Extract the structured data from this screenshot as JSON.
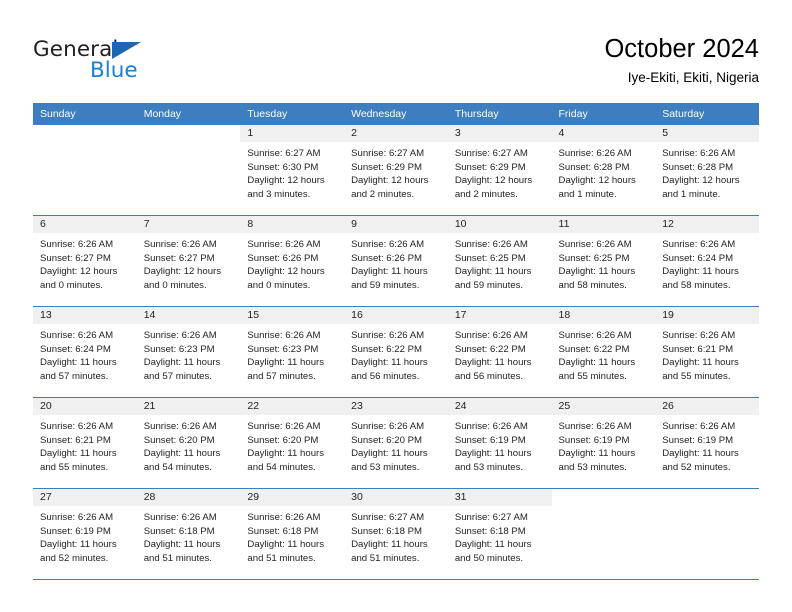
{
  "brand": {
    "name_part1": "General",
    "name_part2": "Blue",
    "triangle_color": "#1b67b2",
    "blue_color": "#1b7fd4"
  },
  "header": {
    "title": "October 2024",
    "subtitle": "Iye-Ekiti, Ekiti, Nigeria"
  },
  "theme": {
    "header_blue": "#3c7ebf",
    "daynum_band": "#f0f0f0",
    "cell_bg": "#ffffff",
    "text": "#231f20"
  },
  "weekdays": [
    "Sunday",
    "Monday",
    "Tuesday",
    "Wednesday",
    "Thursday",
    "Friday",
    "Saturday"
  ],
  "weeks": [
    [
      {
        "day": "",
        "sunrise": "",
        "sunset": "",
        "daylight1": "",
        "daylight2": "",
        "blank": true
      },
      {
        "day": "",
        "sunrise": "",
        "sunset": "",
        "daylight1": "",
        "daylight2": "",
        "blank": true
      },
      {
        "day": "1",
        "sunrise": "Sunrise: 6:27 AM",
        "sunset": "Sunset: 6:30 PM",
        "daylight1": "Daylight: 12 hours",
        "daylight2": "and 3 minutes."
      },
      {
        "day": "2",
        "sunrise": "Sunrise: 6:27 AM",
        "sunset": "Sunset: 6:29 PM",
        "daylight1": "Daylight: 12 hours",
        "daylight2": "and 2 minutes."
      },
      {
        "day": "3",
        "sunrise": "Sunrise: 6:27 AM",
        "sunset": "Sunset: 6:29 PM",
        "daylight1": "Daylight: 12 hours",
        "daylight2": "and 2 minutes."
      },
      {
        "day": "4",
        "sunrise": "Sunrise: 6:26 AM",
        "sunset": "Sunset: 6:28 PM",
        "daylight1": "Daylight: 12 hours",
        "daylight2": "and 1 minute."
      },
      {
        "day": "5",
        "sunrise": "Sunrise: 6:26 AM",
        "sunset": "Sunset: 6:28 PM",
        "daylight1": "Daylight: 12 hours",
        "daylight2": "and 1 minute."
      }
    ],
    [
      {
        "day": "6",
        "sunrise": "Sunrise: 6:26 AM",
        "sunset": "Sunset: 6:27 PM",
        "daylight1": "Daylight: 12 hours",
        "daylight2": "and 0 minutes."
      },
      {
        "day": "7",
        "sunrise": "Sunrise: 6:26 AM",
        "sunset": "Sunset: 6:27 PM",
        "daylight1": "Daylight: 12 hours",
        "daylight2": "and 0 minutes."
      },
      {
        "day": "8",
        "sunrise": "Sunrise: 6:26 AM",
        "sunset": "Sunset: 6:26 PM",
        "daylight1": "Daylight: 12 hours",
        "daylight2": "and 0 minutes."
      },
      {
        "day": "9",
        "sunrise": "Sunrise: 6:26 AM",
        "sunset": "Sunset: 6:26 PM",
        "daylight1": "Daylight: 11 hours",
        "daylight2": "and 59 minutes."
      },
      {
        "day": "10",
        "sunrise": "Sunrise: 6:26 AM",
        "sunset": "Sunset: 6:25 PM",
        "daylight1": "Daylight: 11 hours",
        "daylight2": "and 59 minutes."
      },
      {
        "day": "11",
        "sunrise": "Sunrise: 6:26 AM",
        "sunset": "Sunset: 6:25 PM",
        "daylight1": "Daylight: 11 hours",
        "daylight2": "and 58 minutes."
      },
      {
        "day": "12",
        "sunrise": "Sunrise: 6:26 AM",
        "sunset": "Sunset: 6:24 PM",
        "daylight1": "Daylight: 11 hours",
        "daylight2": "and 58 minutes."
      }
    ],
    [
      {
        "day": "13",
        "sunrise": "Sunrise: 6:26 AM",
        "sunset": "Sunset: 6:24 PM",
        "daylight1": "Daylight: 11 hours",
        "daylight2": "and 57 minutes."
      },
      {
        "day": "14",
        "sunrise": "Sunrise: 6:26 AM",
        "sunset": "Sunset: 6:23 PM",
        "daylight1": "Daylight: 11 hours",
        "daylight2": "and 57 minutes."
      },
      {
        "day": "15",
        "sunrise": "Sunrise: 6:26 AM",
        "sunset": "Sunset: 6:23 PM",
        "daylight1": "Daylight: 11 hours",
        "daylight2": "and 57 minutes."
      },
      {
        "day": "16",
        "sunrise": "Sunrise: 6:26 AM",
        "sunset": "Sunset: 6:22 PM",
        "daylight1": "Daylight: 11 hours",
        "daylight2": "and 56 minutes."
      },
      {
        "day": "17",
        "sunrise": "Sunrise: 6:26 AM",
        "sunset": "Sunset: 6:22 PM",
        "daylight1": "Daylight: 11 hours",
        "daylight2": "and 56 minutes."
      },
      {
        "day": "18",
        "sunrise": "Sunrise: 6:26 AM",
        "sunset": "Sunset: 6:22 PM",
        "daylight1": "Daylight: 11 hours",
        "daylight2": "and 55 minutes."
      },
      {
        "day": "19",
        "sunrise": "Sunrise: 6:26 AM",
        "sunset": "Sunset: 6:21 PM",
        "daylight1": "Daylight: 11 hours",
        "daylight2": "and 55 minutes."
      }
    ],
    [
      {
        "day": "20",
        "sunrise": "Sunrise: 6:26 AM",
        "sunset": "Sunset: 6:21 PM",
        "daylight1": "Daylight: 11 hours",
        "daylight2": "and 55 minutes."
      },
      {
        "day": "21",
        "sunrise": "Sunrise: 6:26 AM",
        "sunset": "Sunset: 6:20 PM",
        "daylight1": "Daylight: 11 hours",
        "daylight2": "and 54 minutes."
      },
      {
        "day": "22",
        "sunrise": "Sunrise: 6:26 AM",
        "sunset": "Sunset: 6:20 PM",
        "daylight1": "Daylight: 11 hours",
        "daylight2": "and 54 minutes."
      },
      {
        "day": "23",
        "sunrise": "Sunrise: 6:26 AM",
        "sunset": "Sunset: 6:20 PM",
        "daylight1": "Daylight: 11 hours",
        "daylight2": "and 53 minutes."
      },
      {
        "day": "24",
        "sunrise": "Sunrise: 6:26 AM",
        "sunset": "Sunset: 6:19 PM",
        "daylight1": "Daylight: 11 hours",
        "daylight2": "and 53 minutes."
      },
      {
        "day": "25",
        "sunrise": "Sunrise: 6:26 AM",
        "sunset": "Sunset: 6:19 PM",
        "daylight1": "Daylight: 11 hours",
        "daylight2": "and 53 minutes."
      },
      {
        "day": "26",
        "sunrise": "Sunrise: 6:26 AM",
        "sunset": "Sunset: 6:19 PM",
        "daylight1": "Daylight: 11 hours",
        "daylight2": "and 52 minutes."
      }
    ],
    [
      {
        "day": "27",
        "sunrise": "Sunrise: 6:26 AM",
        "sunset": "Sunset: 6:19 PM",
        "daylight1": "Daylight: 11 hours",
        "daylight2": "and 52 minutes."
      },
      {
        "day": "28",
        "sunrise": "Sunrise: 6:26 AM",
        "sunset": "Sunset: 6:18 PM",
        "daylight1": "Daylight: 11 hours",
        "daylight2": "and 51 minutes."
      },
      {
        "day": "29",
        "sunrise": "Sunrise: 6:26 AM",
        "sunset": "Sunset: 6:18 PM",
        "daylight1": "Daylight: 11 hours",
        "daylight2": "and 51 minutes."
      },
      {
        "day": "30",
        "sunrise": "Sunrise: 6:27 AM",
        "sunset": "Sunset: 6:18 PM",
        "daylight1": "Daylight: 11 hours",
        "daylight2": "and 51 minutes."
      },
      {
        "day": "31",
        "sunrise": "Sunrise: 6:27 AM",
        "sunset": "Sunset: 6:18 PM",
        "daylight1": "Daylight: 11 hours",
        "daylight2": "and 50 minutes."
      },
      {
        "day": "",
        "sunrise": "",
        "sunset": "",
        "daylight1": "",
        "daylight2": "",
        "blank": true
      },
      {
        "day": "",
        "sunrise": "",
        "sunset": "",
        "daylight1": "",
        "daylight2": "",
        "blank": true
      }
    ]
  ]
}
